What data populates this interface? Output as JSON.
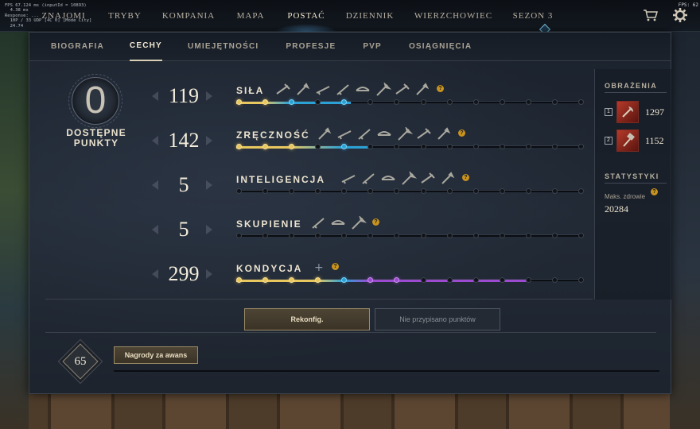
{
  "debug_overlay": "FPS 67.124 ms (inputId = 10893)\n  4.38 ms\nResponse: ...\n  10P / 33 UDP [4C 0] [Mode City]\n  24.74",
  "fps_label": "FPS: 62",
  "topnav": {
    "items": [
      {
        "label": "Znajomi",
        "active": false
      },
      {
        "label": "Tryby",
        "active": false
      },
      {
        "label": "Kompania",
        "active": false
      },
      {
        "label": "Mapa",
        "active": false
      },
      {
        "label": "Postać",
        "active": true
      },
      {
        "label": "Dziennik",
        "active": false
      },
      {
        "label": "Wierzchowiec",
        "active": false
      },
      {
        "label": "Sezon 3",
        "active": false
      }
    ]
  },
  "subnav": {
    "tabs": [
      {
        "label": "Biografia",
        "active": false
      },
      {
        "label": "Cechy",
        "active": true
      },
      {
        "label": "Umiejętności",
        "active": false
      },
      {
        "label": "Profesje",
        "active": false
      },
      {
        "label": "PvP",
        "active": false
      },
      {
        "label": "Osiągnięcia",
        "active": false
      }
    ]
  },
  "points": {
    "available": "0",
    "label": "Dostępne punkty"
  },
  "attributes": [
    {
      "name": "Siła",
      "value": "119",
      "weapons": 8,
      "nodes": [
        "gold",
        "gold",
        "blue",
        "dark",
        "blue",
        "dark",
        "dark",
        "dark",
        "dark",
        "dark",
        "dark",
        "dark",
        "dark",
        "dark"
      ],
      "fill_to": 0.33
    },
    {
      "name": "Zręczność",
      "value": "142",
      "weapons": 7,
      "nodes": [
        "gold",
        "gold",
        "gold",
        "dark",
        "blue",
        "dark",
        "dark",
        "dark",
        "dark",
        "dark",
        "dark",
        "dark",
        "dark",
        "dark"
      ],
      "fill_to": 0.39
    },
    {
      "name": "Inteligencja",
      "value": "5",
      "weapons": 6,
      "nodes": [
        "dark",
        "dark",
        "dark",
        "dark",
        "dark",
        "dark",
        "dark",
        "dark",
        "dark",
        "dark",
        "dark",
        "dark",
        "dark",
        "dark"
      ],
      "fill_to": 0.0
    },
    {
      "name": "Skupienie",
      "value": "5",
      "weapons": 3,
      "nodes": [
        "dark",
        "dark",
        "dark",
        "dark",
        "dark",
        "dark",
        "dark",
        "dark",
        "dark",
        "dark",
        "dark",
        "dark",
        "dark",
        "dark"
      ],
      "fill_to": 0.0
    },
    {
      "name": "Kondycja",
      "value": "299",
      "weapons": 0,
      "nodes": [
        "gold",
        "gold",
        "gold",
        "gold",
        "blue",
        "purple",
        "purple",
        "dark",
        "dark",
        "dark",
        "dark",
        "dark",
        "dark",
        "dark"
      ],
      "fill_to": 0.84
    }
  ],
  "side": {
    "damage_heading": "Obrażenia",
    "damage": [
      {
        "slot": "1",
        "value": "1297"
      },
      {
        "slot": "2",
        "value": "1152"
      }
    ],
    "stats_heading": "Statystyki",
    "max_health_label": "Maks. zdrowie",
    "max_health_value": "20284"
  },
  "buttons": {
    "respec": "Rekonfig.",
    "unassigned": "Nie przypisano punktów",
    "rewards": "Nagrody za awans"
  },
  "level": "65",
  "colors": {
    "gold": "#e8c75f",
    "blue": "#2aa2d6",
    "purple": "#9c4ad0",
    "accent_button": "#4d4434"
  }
}
